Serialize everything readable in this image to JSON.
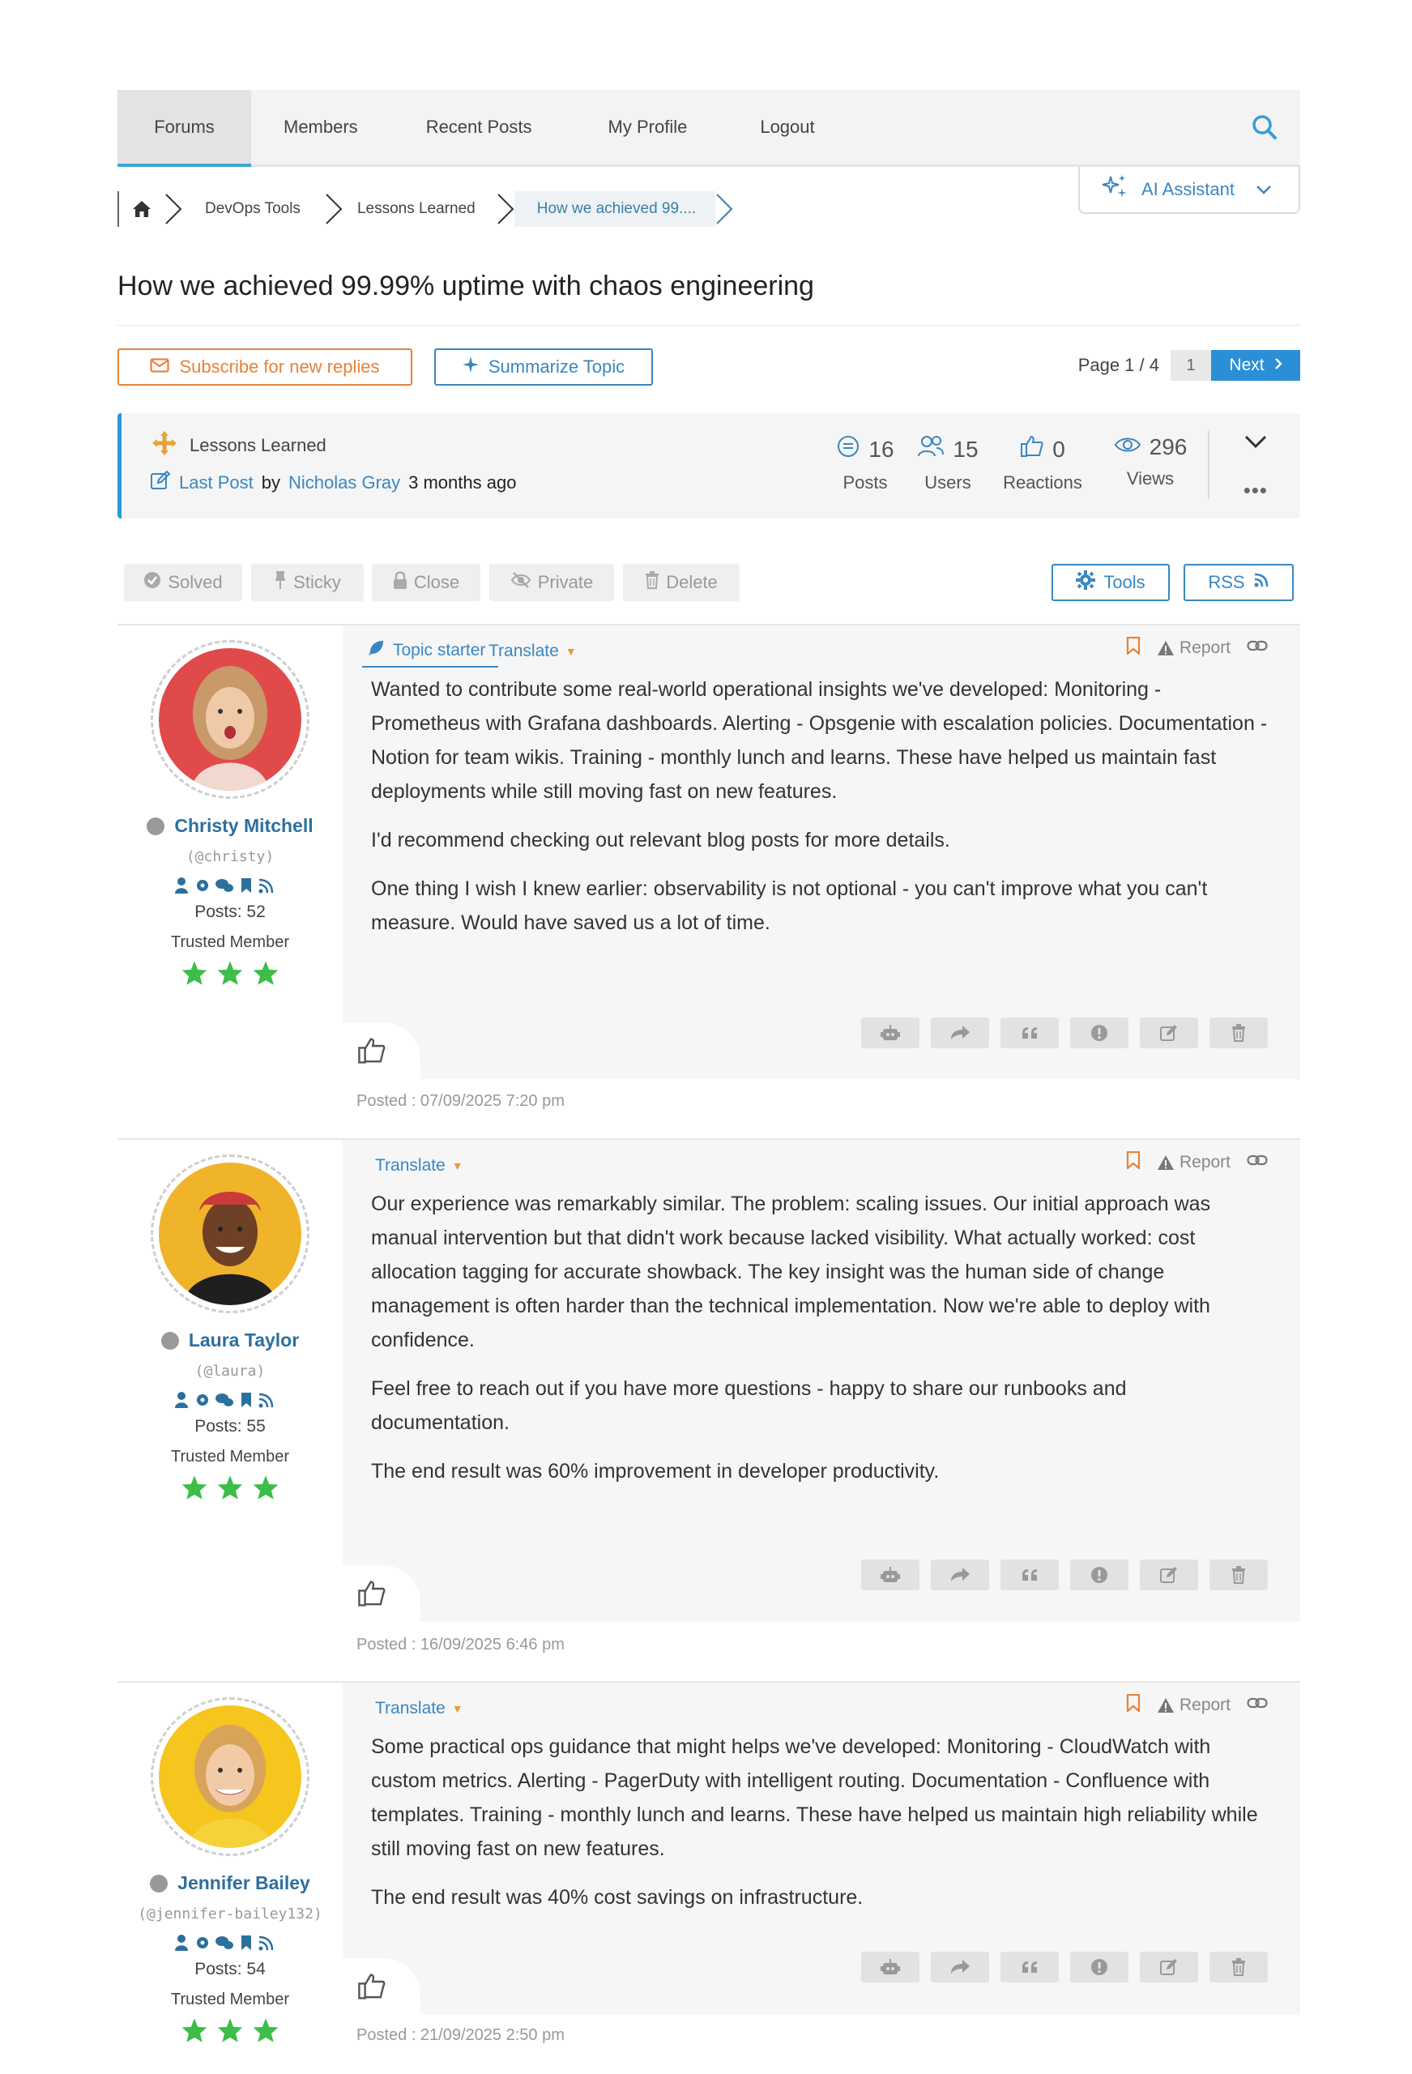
{
  "nav": {
    "tabs": [
      "Forums",
      "Members",
      "Recent Posts",
      "My Profile",
      "Logout"
    ],
    "active": "Forums"
  },
  "breadcrumb": {
    "items": [
      "DevOps Tools",
      "Lessons Learned"
    ],
    "current": "How we achieved 99...."
  },
  "ai_assistant": {
    "label": "AI Assistant"
  },
  "topic": {
    "title": "How we achieved 99.99% uptime with chaos engineering"
  },
  "actions": {
    "subscribe": "Subscribe for new replies",
    "summarize": "Summarize Topic"
  },
  "pager": {
    "label": "Page 1 / 4",
    "page": "1",
    "next": "Next"
  },
  "info": {
    "forum": "Lessons Learned",
    "last_post_label": "Last Post",
    "by": "by",
    "last_post_author": "Nicholas Gray",
    "last_post_time": "3 months ago",
    "stats": [
      {
        "value": "16",
        "label": "Posts"
      },
      {
        "value": "15",
        "label": "Users"
      },
      {
        "value": "0",
        "label": "Reactions"
      },
      {
        "value": "296",
        "label": "Views"
      }
    ]
  },
  "moderation": {
    "solved": "Solved",
    "sticky": "Sticky",
    "close": "Close",
    "private": "Private",
    "delete": "Delete",
    "tools": "Tools",
    "rss": "RSS"
  },
  "post_labels": {
    "topic_starter": "Topic starter",
    "translate": "Translate",
    "report": "Report"
  },
  "posts": [
    {
      "name": "Christy Mitchell",
      "handle": "(@christy)",
      "posts": "Posts: 52",
      "rank": "Trusted Member",
      "paragraphs": [
        "Wanted to contribute some real-world operational insights we've developed: Monitoring - Prometheus with Grafana dashboards. Alerting - Opsgenie with escalation policies. Documentation - Notion for team wikis. Training - monthly lunch and learns. These have helped us maintain fast deployments while still moving fast on new features.",
        "I'd recommend checking out relevant blog posts for more details.",
        "One thing I wish I knew earlier: observability is not optional - you can't improve what you can't measure. Would have saved us a lot of time."
      ],
      "posted": "Posted : 07/09/2025 7:20 pm",
      "avatar_color": "#e24b4b"
    },
    {
      "name": "Laura Taylor",
      "handle": "(@laura)",
      "posts": "Posts: 55",
      "rank": "Trusted Member",
      "paragraphs": [
        "Our experience was remarkably similar. The problem: scaling issues. Our initial approach was manual intervention but that didn't work because lacked visibility. What actually worked: cost allocation tagging for accurate showback. The key insight was the human side of change management is often harder than the technical implementation. Now we're able to deploy with confidence.",
        "Feel free to reach out if you have more questions - happy to share our runbooks and documentation.",
        "The end result was 60% improvement in developer productivity."
      ],
      "posted": "Posted : 16/09/2025 6:46 pm",
      "avatar_color": "#f0b42a"
    },
    {
      "name": "Jennifer Bailey",
      "handle": "(@jennifer-bailey132)",
      "posts": "Posts: 54",
      "rank": "Trusted Member",
      "paragraphs": [
        "Some practical ops guidance that might helps we've developed: Monitoring - CloudWatch with custom metrics. Alerting - PagerDuty with intelligent routing. Documentation - Confluence with templates. Training - monthly lunch and learns. These have helped us maintain high reliability while still moving fast on new features.",
        "The end result was 40% cost savings on infrastructure."
      ],
      "posted": "Posted : 21/09/2025 2:50 pm",
      "avatar_color": "#f6c51e"
    }
  ],
  "colors": {
    "accent": "#3a87c0",
    "orange": "#e6823a",
    "star": "#3dbd4a",
    "next": "#2a8fd6"
  }
}
